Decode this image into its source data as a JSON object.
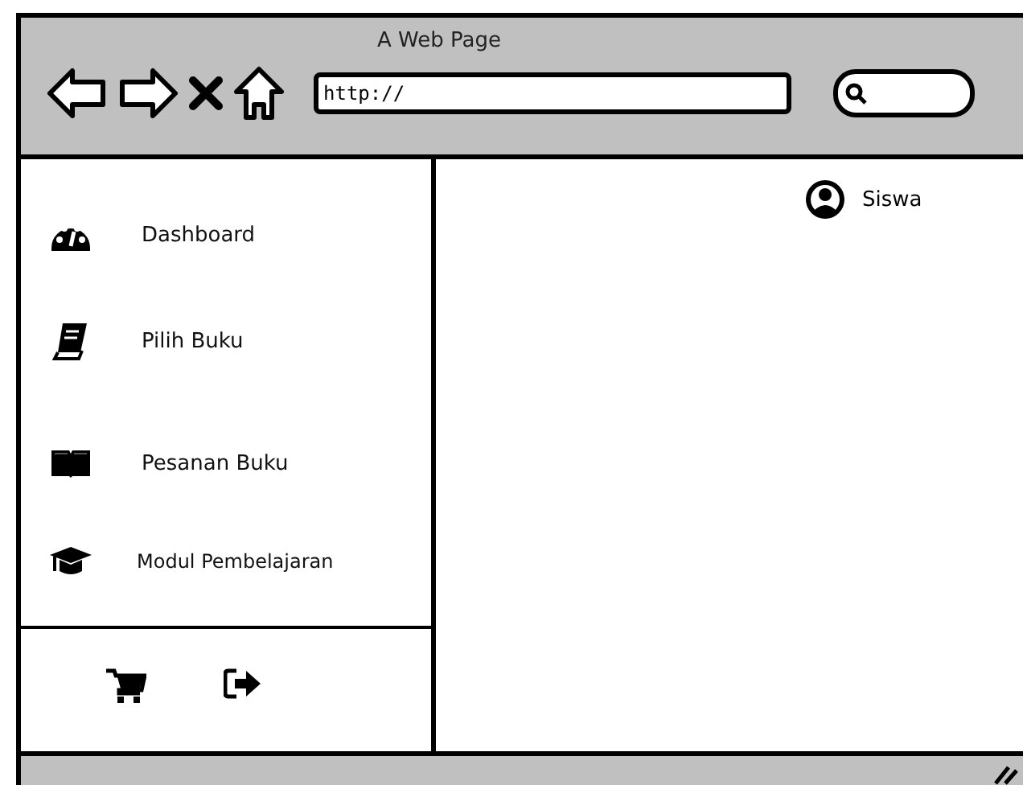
{
  "window": {
    "title": "A Web Page"
  },
  "address_bar": {
    "value": "http://"
  },
  "user": {
    "name": "Siswa"
  },
  "sidebar": {
    "items": [
      {
        "label": "Dashboard"
      },
      {
        "label": "Pilih Buku"
      },
      {
        "label": "Pesanan Buku"
      },
      {
        "label": "Modul Pembelajaran"
      }
    ]
  }
}
